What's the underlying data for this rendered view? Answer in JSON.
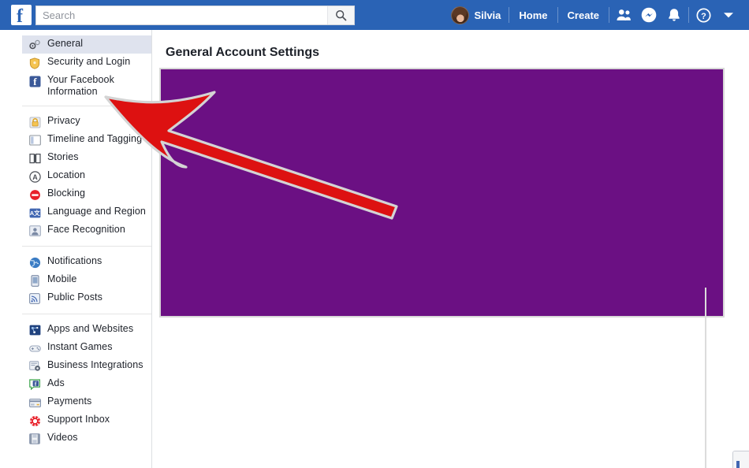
{
  "topbar": {
    "logo_icon": "facebook-logo-icon",
    "search": {
      "placeholder": "Search",
      "value": "",
      "icon": "search-icon"
    },
    "profile_name": "Silvia",
    "home_label": "Home",
    "create_label": "Create",
    "icons": [
      {
        "name": "friend-requests-icon"
      },
      {
        "name": "messenger-icon"
      },
      {
        "name": "notifications-bell-icon"
      },
      {
        "name": "help-question-icon"
      },
      {
        "name": "account-chevron-down-icon"
      }
    ],
    "background_color": "#2a63b5"
  },
  "sidebar": {
    "groups": [
      {
        "items": [
          {
            "label": "General",
            "icon": "gear-icon",
            "selected": true
          },
          {
            "label": "Security and Login",
            "icon": "shield-icon",
            "selected": false
          },
          {
            "label": "Your Facebook Information",
            "icon": "facebook-square-icon",
            "selected": false
          }
        ]
      },
      {
        "items": [
          {
            "label": "Privacy",
            "icon": "lock-icon",
            "selected": false
          },
          {
            "label": "Timeline and Tagging",
            "icon": "timeline-icon",
            "selected": false
          },
          {
            "label": "Stories",
            "icon": "book-icon",
            "selected": false
          },
          {
            "label": "Location",
            "icon": "location-circle-icon",
            "selected": false
          },
          {
            "label": "Blocking",
            "icon": "block-icon",
            "selected": false
          },
          {
            "label": "Language and Region",
            "icon": "language-icon",
            "selected": false
          },
          {
            "label": "Face Recognition",
            "icon": "face-recognition-icon",
            "selected": false
          }
        ]
      },
      {
        "items": [
          {
            "label": "Notifications",
            "icon": "globe-icon",
            "selected": false
          },
          {
            "label": "Mobile",
            "icon": "mobile-phone-icon",
            "selected": false
          },
          {
            "label": "Public Posts",
            "icon": "rss-icon",
            "selected": false
          }
        ]
      },
      {
        "items": [
          {
            "label": "Apps and Websites",
            "icon": "apps-icon",
            "selected": false
          },
          {
            "label": "Instant Games",
            "icon": "gamepad-icon",
            "selected": false
          },
          {
            "label": "Business Integrations",
            "icon": "business-gear-icon",
            "selected": false
          },
          {
            "label": "Ads",
            "icon": "ads-icon",
            "selected": false
          },
          {
            "label": "Payments",
            "icon": "credit-card-icon",
            "selected": false
          },
          {
            "label": "Support Inbox",
            "icon": "lifebuoy-icon",
            "selected": false
          },
          {
            "label": "Videos",
            "icon": "film-icon",
            "selected": false
          }
        ]
      }
    ]
  },
  "main": {
    "page_title": "General Account Settings",
    "content_panel": {
      "name": "redacted-content-panel",
      "fill_color": "#6B1083",
      "border_color": "#d8d8d8"
    }
  },
  "annotation": {
    "arrow": {
      "name": "pointer-arrow-annotation",
      "color": "#dd1111",
      "outline_color": "#d4d4d4",
      "points_to": "Your Facebook Information"
    }
  }
}
